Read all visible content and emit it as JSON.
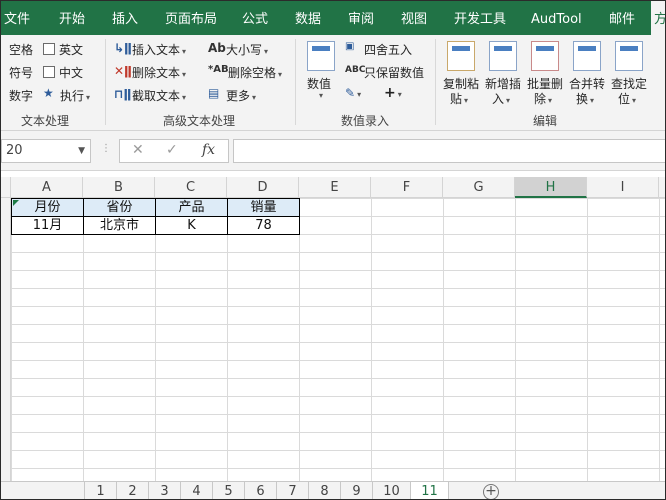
{
  "menu_tabs": [
    "文件",
    "开始",
    "插入",
    "页面布局",
    "公式",
    "数据",
    "审阅",
    "视图",
    "开发工具",
    "AudTool",
    "邮件",
    "方"
  ],
  "ribbon": {
    "text_group": {
      "items": [
        "空格",
        "英文",
        "符号",
        "中文",
        "数字",
        "执行"
      ],
      "label": "文本处理"
    },
    "advanced_group": {
      "items": [
        "插入文本",
        "删除文本",
        "截取文本",
        "大小写",
        "删除空格",
        "更多"
      ],
      "label": "高级文本处理"
    },
    "number_group": {
      "big_button": [
        "数值"
      ],
      "items": [
        "四舍五入",
        "只保留数值"
      ],
      "label": "数值录入"
    },
    "edit_group": {
      "buttons": [
        [
          "复制粘",
          "贴"
        ],
        [
          "新增插",
          "入"
        ],
        [
          "批量删",
          "除"
        ],
        [
          "合并转",
          "换"
        ],
        [
          "查找定",
          "位"
        ]
      ],
      "label": "编辑"
    }
  },
  "name_box": "20",
  "fx_label": "fx",
  "columns": [
    "A",
    "B",
    "C",
    "D",
    "E",
    "F",
    "G",
    "H",
    "I"
  ],
  "selected_column": "H",
  "table": {
    "headers": [
      "月份",
      "省份",
      "产品",
      "销量"
    ],
    "rows": [
      [
        "11月",
        "北京市",
        "K",
        "78"
      ]
    ]
  },
  "sheets": [
    "1",
    "2",
    "3",
    "4",
    "5",
    "6",
    "7",
    "8",
    "9",
    "10",
    "11"
  ],
  "active_sheet": "11",
  "colors": {
    "accent": "#217346",
    "header_fill": "#ddebf7"
  }
}
